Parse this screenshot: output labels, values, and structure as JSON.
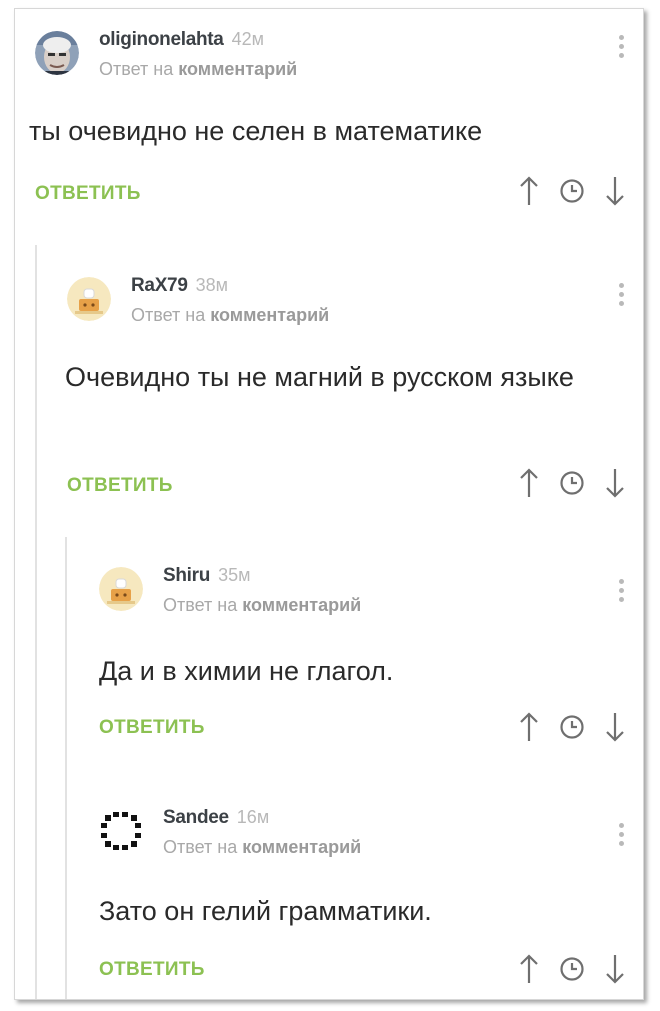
{
  "comments": [
    {
      "author": "oliginonelahta",
      "time": "42м",
      "reply_prefix": "Ответ на",
      "reply_link": "комментарий",
      "text": "ты очевидно не селен в математике",
      "answer_label": "ОТВЕТИТЬ",
      "avatar": "photo-avatar"
    },
    {
      "author": "RaX79",
      "time": "38м",
      "reply_prefix": "Ответ на",
      "reply_link": "комментарий",
      "text": "Очевидно ты не магний в русском языке",
      "answer_label": "ОТВЕТИТЬ",
      "avatar": "default-cook-avatar"
    },
    {
      "author": "Shiru",
      "time": "35м",
      "reply_prefix": "Ответ на",
      "reply_link": "комментарий",
      "text": "Да и в химии не глагол.",
      "answer_label": "ОТВЕТИТЬ",
      "avatar": "default-cook-avatar"
    },
    {
      "author": "Sandee",
      "time": "16м",
      "reply_prefix": "Ответ на",
      "reply_link": "комментарий",
      "text": "Зато он гелий грамматики.",
      "answer_label": "ОТВЕТИТЬ",
      "avatar": "pixel-ring-avatar"
    }
  ],
  "colors": {
    "accent_green": "#8cc152",
    "author": "#3c4146",
    "muted": "#a8a8a8",
    "thread_line": "#e2e2e2"
  },
  "icons": [
    "arrow-up-icon",
    "clock-icon",
    "arrow-down-icon",
    "more-vertical-icon"
  ]
}
